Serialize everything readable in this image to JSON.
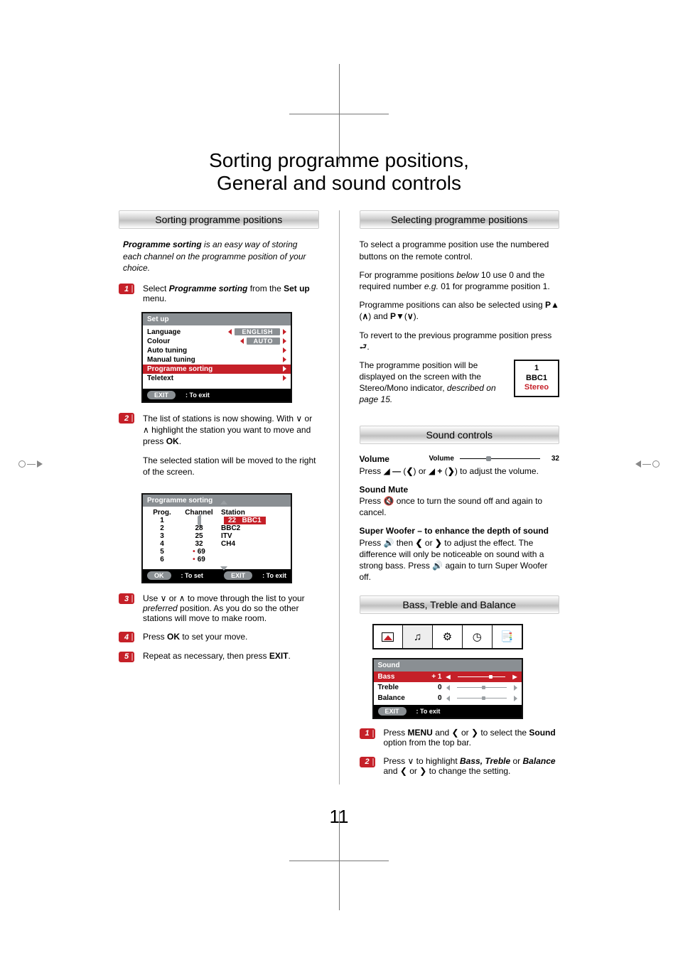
{
  "title_l1": "Sorting programme positions,",
  "title_l2": "General and sound controls",
  "page_number": "11",
  "left": {
    "section_title": "Sorting programme positions",
    "intro_bold": "Programme sorting",
    "intro_rest": " is an easy way of storing each channel on the programme position of your choice.",
    "step1_a": "Select ",
    "step1_b": "Programme sorting",
    "step1_c": " from the ",
    "step1_d": "Set up",
    "step1_e": " menu.",
    "setup": {
      "title": "Set up",
      "rows": [
        {
          "label": "Language",
          "pill": "ENGLISH",
          "sel": false,
          "arr": true
        },
        {
          "label": "Colour",
          "pill": "AUTO",
          "sel": false,
          "arr": true
        },
        {
          "label": "Auto tuning",
          "sel": false,
          "right": true
        },
        {
          "label": "Manual tuning",
          "sel": false,
          "right": true
        },
        {
          "label": "Programme sorting",
          "sel": true,
          "right": true
        },
        {
          "label": "Teletext",
          "sel": false,
          "right": true
        }
      ],
      "hint_btn": "EXIT",
      "hint_txt": ": To exit"
    },
    "step2": "The list of stations is now showing. With ∨ or ∧ highlight the station you want to move and press ",
    "step2_btn": "OK",
    "step2_tail": ".",
    "step2b": "The selected station will be moved to the right of the screen.",
    "ps": {
      "title": "Programme sorting",
      "hdr": {
        "c1": "Prog.",
        "c2": "Channel",
        "c3": "Station"
      },
      "rows": [
        {
          "p": "1",
          "ch": "",
          "st": "",
          "sel": true,
          "sel_ch": "22",
          "sel_st": "BBC1"
        },
        {
          "p": "2",
          "ch": "28",
          "st": "BBC2"
        },
        {
          "p": "3",
          "ch": "25",
          "st": "ITV"
        },
        {
          "p": "4",
          "ch": "32",
          "st": "CH4"
        },
        {
          "p": "5",
          "ch": "69",
          "st": "",
          "dot": true
        },
        {
          "p": "6",
          "ch": "69",
          "st": "",
          "dot": true
        }
      ],
      "hint_ok": "OK",
      "hint_ok_t": ": To set",
      "hint_ex": "EXIT",
      "hint_ex_t": ": To exit"
    },
    "step3": "Use ∨ or ∧ to move through the list to your ",
    "step3_i": "preferred",
    "step3_b": " position. As you do so the other stations will move to make room.",
    "step4_a": "Press ",
    "step4_b": "OK",
    "step4_c": " to set your move.",
    "step5_a": "Repeat as necessary, then press ",
    "step5_b": "EXIT",
    "step5_c": "."
  },
  "right": {
    "sel_title": "Selecting programme positions",
    "p1": "To select a programme position use the numbered buttons on the remote control.",
    "p2": "For programme positions below 10 use 0 and the required number e.g. 01 for programme position 1.",
    "p3": "Programme positions can also be selected using P▲ (∧) and P▼(∨).",
    "p4": "To revert to the previous programme position press ⮐.",
    "status_pre": "The programme position will be displayed on the screen with the Stereo/Mono indicator, ",
    "status_i": "described on page 15.",
    "status": {
      "num": "1",
      "ch": "BBC1",
      "mode": "Stereo"
    },
    "snd_title": "Sound controls",
    "vol_label": "Volume",
    "vol_small": "Volume",
    "vol_num": "32",
    "vol_text": "Press 🔇 — (❮) or 🔊 + (❯) to adjust the volume.",
    "mute_h": "Sound Mute",
    "mute_t": "Press 🔇 once to turn the sound off and again to cancel.",
    "sw_h": "Super Woofer – to enhance the depth of sound",
    "sw_t": "Press 🔊 then ❮ or ❯ to adjust the effect. The difference will only be noticeable on sound with a strong bass. Press 🔊 again to turn Super Woofer off.",
    "btb_title": "Bass, Treble and Balance",
    "sound_osd": {
      "title": "Sound",
      "rows": [
        {
          "label": "Bass",
          "val": "+ 1",
          "sel": true,
          "k": 0.65
        },
        {
          "label": "Treble",
          "val": "0",
          "k": 0.5
        },
        {
          "label": "Balance",
          "val": "0",
          "k": 0.5
        }
      ],
      "hint_btn": "EXIT",
      "hint_txt": ": To exit"
    },
    "bstep1_a": "Press ",
    "bstep1_b": "MENU",
    "bstep1_c": " and ❮ or ❯ to select the ",
    "bstep1_d": "Sound",
    "bstep1_e": " option from the top bar.",
    "bstep2_a": "Press ∨ to highlight ",
    "bstep2_b": "Bass, Treble",
    "bstep2_c": " or ",
    "bstep2_d": "Balance",
    "bstep2_e": " and ❮ or ❯ to change the setting."
  }
}
